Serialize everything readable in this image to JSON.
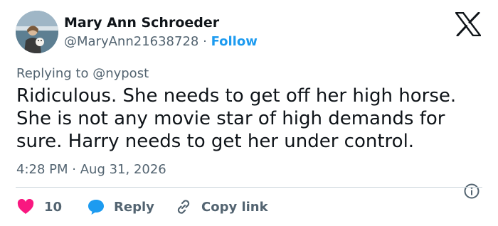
{
  "author": {
    "name": "Mary Ann Schroeder",
    "handle": "@MaryAnn21638728",
    "separator": "·",
    "follow_label": "Follow"
  },
  "brand_icon": "x-logo-icon",
  "reply_context": "Replying to @nypost",
  "tweet": {
    "lines": [
      "Ridiculous.  She needs to get off her high horse.",
      "She is not any movie star of high demands for",
      "sure. Harry needs to get her under control."
    ],
    "time": "4:28 PM",
    "separator": "·",
    "date": "Aug 31, 2026"
  },
  "actions": {
    "like_count": "10",
    "reply_label": "Reply",
    "copy_link_label": "Copy link"
  },
  "colors": {
    "accent": "#1d9bf0",
    "like": "#f91880",
    "text": "#0f1419",
    "muted": "#536471",
    "divider": "#cfd9de"
  }
}
